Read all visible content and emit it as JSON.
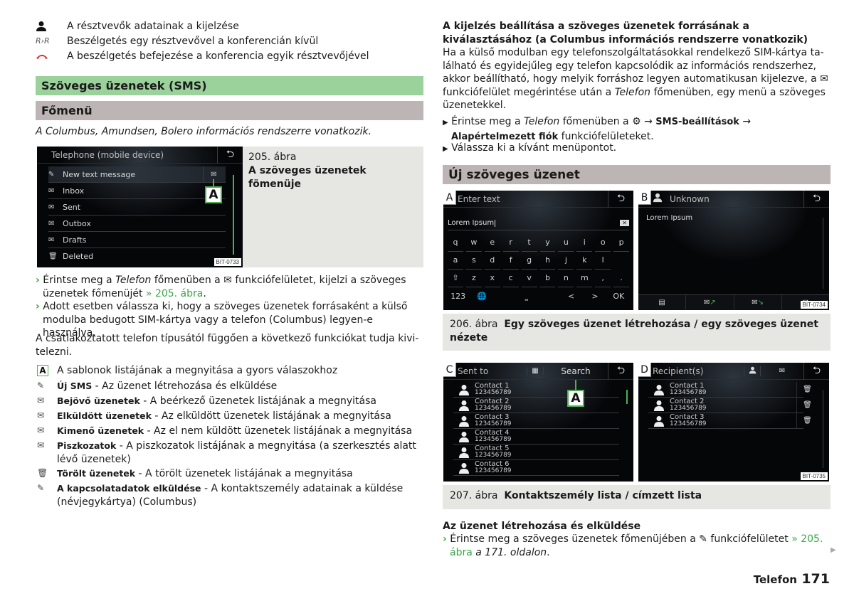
{
  "legend_top": [
    {
      "icon": "person-icon",
      "text": "A résztvevők adatainak a kijelzése"
    },
    {
      "icon": "private-call-icon",
      "text": "Beszélgetés egy résztvevővel a konferencián kívül"
    },
    {
      "icon": "hang-up-icon",
      "text": "A beszélgetés befejezése a konferencia egyik résztvevőjével"
    }
  ],
  "section_title": "Szöveges üzenetek (SMS)",
  "subsection_main_menu": "Főmenü",
  "applies_to": "A Columbus, Amundsen, Bolero információs rendszerre vonatkozik.",
  "fig205": {
    "screen_title": "Telephone (mobile device)",
    "menu": [
      {
        "icon": "new-message-icon",
        "label": "New text message"
      },
      {
        "icon": "inbox-icon",
        "label": "Inbox"
      },
      {
        "icon": "sent-icon",
        "label": "Sent"
      },
      {
        "icon": "outbox-icon",
        "label": "Outbox"
      },
      {
        "icon": "drafts-icon",
        "label": "Drafts"
      },
      {
        "icon": "trash-icon",
        "label": "Deleted"
      }
    ],
    "callout": "A",
    "code": "BIT-0733",
    "caption_num": "205. ábra",
    "caption_title": "A szöveges üzenetek fömenüje"
  },
  "steps_left": [
    {
      "pre": "Érintse meg a ",
      "italic": "Telefon",
      "post": " főmenüben a ✉ funkciófelületet, kijelzi a szöveges üzenetek főmenüjét ",
      "link": "» 205. ábra",
      "end": "."
    },
    {
      "pre": "Adott esetben válassza ki, hogy a szöveges üzenetek forrásaként a külső modulba bedugott SIM-kártya vagy a telefon (Columbus) legyen-e használva.",
      "italic": "",
      "post": "",
      "link": "",
      "end": ""
    }
  ],
  "functions_intro": "A csatlakoztatott telefon típusától függően a következő funkciókat tudja kivi­telezni.",
  "functions": [
    {
      "icon": "callout-a-icon",
      "term": "",
      "desc": "A sablonok listájának a megnyitása a gyors válaszokhoz"
    },
    {
      "icon": "new-message-icon",
      "term": "Új SMS",
      "desc": " - Az üzenet létrehozása és elküldése"
    },
    {
      "icon": "inbox-icon",
      "term": "Bejövő üzenetek",
      "desc": " - A beérkező üzenetek listájának a megnyitása"
    },
    {
      "icon": "sent-icon",
      "term": "Elküldött üzenetek",
      "desc": " - Az elküldött üzenetek listájának a megnyitása"
    },
    {
      "icon": "outbox-icon",
      "term": "Kimenő üzenetek",
      "desc": " - Az el nem küldött üzenetek listájának a megnyitása"
    },
    {
      "icon": "drafts-icon",
      "term": "Piszkozatok",
      "desc": " - A piszkozatok listájának a megnyitása (a szerkesztés alatt lévő üzenetek)"
    },
    {
      "icon": "trash-icon",
      "term": "Törölt üzenetek",
      "desc": " - A törölt üzenetek listájának a megnyitása"
    },
    {
      "icon": "send-contact-icon",
      "term": "A kapcsolatadatok elküldése",
      "desc": " - A kontaktszemély adatainak a küldése (névjegy­kártya) (Columbus)"
    }
  ],
  "right_heading": "A kijelzés beállítása a szöveges üzenetek forrásának a kiválasztásához (a Columbus információs rendszerre vonatkozik)",
  "right_para_1": "Ha a külső modulban egy telefonszolgáltatásokkal rendelkező SIM-kártya ta­lálható és egyidejűleg egy telefon kapcsolódik az információs rendszerhez, ak­kor beállítható, hogy melyik forráshoz legyen automatikusan kijelezve, a ✉ funkciófelület megérintése után a ",
  "right_para_italic": "Telefon",
  "right_para_2": " főmenüben, egy menü a szöveges üzenetekkel.",
  "right_steps": [
    {
      "pre": "Érintse meg a ",
      "italic": "Telefon",
      "post": " főmenüben a ⚙ → ",
      "b1": "SMS-beállítások",
      "mid": " → ",
      "b2": "Alapértelmezett fiók",
      "end": " funkciófelületeket."
    },
    {
      "pre": "Válassza ki a kívánt menüpontot.",
      "italic": "",
      "post": "",
      "b1": "",
      "mid": "",
      "b2": "",
      "end": ""
    }
  ],
  "new_message_title": "Új szöveges üzenet",
  "fig206": {
    "A": {
      "tag": "A",
      "placeholder": "Enter text",
      "input_value": "Lorem Ipsum",
      "rows": [
        [
          "q",
          "w",
          "e",
          "r",
          "t",
          "y",
          "u",
          "i",
          "o",
          "p"
        ],
        [
          "a",
          "s",
          "d",
          "f",
          "g",
          "h",
          "j",
          "k",
          "l"
        ],
        [
          "⇧",
          "z",
          "x",
          "c",
          "v",
          "b",
          "n",
          "m",
          ",",
          "."
        ]
      ],
      "bottom": {
        "num": "123",
        "globe": "🌐",
        "space": "⎵",
        "left": "<",
        "right": ">",
        "ok": "OK"
      }
    },
    "B": {
      "tag": "B",
      "title": "Unknown",
      "message": "Lorem Ipsum",
      "code": "BIT-0734"
    },
    "caption_num": "206. ábra",
    "caption_title": "Egy szöveges üzenet létrehozása / egy szöveges üzenet néze­te"
  },
  "fig207": {
    "C": {
      "tag": "C",
      "title": "Sent to",
      "search": "Search",
      "callout": "A",
      "contacts": [
        {
          "name": "Contact 1",
          "number": "123456789"
        },
        {
          "name": "Contact 2",
          "number": "123456789"
        },
        {
          "name": "Contact 3",
          "number": "123456789"
        },
        {
          "name": "Contact 4",
          "number": "123456789"
        },
        {
          "name": "Contact 5",
          "number": "123456789"
        },
        {
          "name": "Contact 6",
          "number": "123456789"
        }
      ]
    },
    "D": {
      "tag": "D",
      "title": "Recipient(s)",
      "contacts": [
        {
          "name": "Contact 1",
          "number": "123456789"
        },
        {
          "name": "Contact 2",
          "number": "123456789"
        },
        {
          "name": "Contact 3",
          "number": "123456789"
        }
      ],
      "code": "BIT-0735"
    },
    "caption_num": "207. ábra",
    "caption_title": "Kontaktszemély lista / címzett lista"
  },
  "create_send_heading": "Az üzenet létrehozása és elküldése",
  "create_send_step": {
    "pre": "Érintse meg a szöveges üzenetek főmenüjében a ✎ funkciófelületet ",
    "link": "» 205. ábra",
    "italic": " a 171. oldalon",
    "end": "."
  },
  "footer": {
    "section": "Telefon",
    "page": "171"
  },
  "colors": {
    "accent_green": "#3aa84b",
    "section_green": "#9bd19b",
    "section_grey": "#bdb5b5",
    "caption_bg": "#e6e6e3",
    "hangup_red": "#d9262c"
  }
}
